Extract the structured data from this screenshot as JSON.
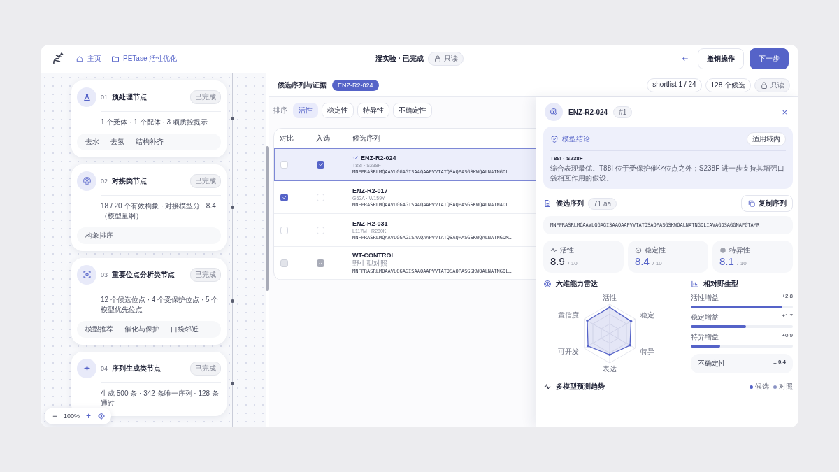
{
  "header": {
    "breadcrumbs": [
      {
        "label": "主页",
        "kind": "home"
      },
      {
        "label": "PETase 活性优化",
        "kind": "folder"
      }
    ],
    "status": "湿实验 · 已完成",
    "status_badge": "只读",
    "actions": [
      {
        "label": "撤销操作",
        "kind": "secondary"
      },
      {
        "label": "下一步",
        "kind": "primary"
      }
    ]
  },
  "pipeline": {
    "nodes": [
      {
        "index": "01",
        "title": "预处理节点",
        "status": "已完成",
        "summary": "1 个受体 · 1 个配体 · 3 项质控提示",
        "tags": [
          "去水",
          "去氢",
          "结构补齐"
        ]
      },
      {
        "index": "02",
        "title": "对接类节点",
        "status": "已完成",
        "summary": "18 / 20 个有效构象 · 对接模型分 −8.4（模型量纲）",
        "tags": [
          "构象排序"
        ]
      },
      {
        "index": "03",
        "title": "重要位点分析类节点",
        "status": "已完成",
        "summary": "12 个候选位点 · 4 个受保护位点 · 5 个模型优先位点",
        "tags": [
          "模型推荐",
          "催化与保护",
          "口袋邻近"
        ]
      },
      {
        "index": "04",
        "title": "序列生成类节点",
        "status": "已完成",
        "summary": "生成 500 条 · 342 条唯一序列 · 128 条通过"
      }
    ],
    "zoom": {
      "minus": "−",
      "value": "100%",
      "plus": "+"
    }
  },
  "candidates": {
    "title": "候选序列与证据",
    "selected_badge": "ENZ-R2-024",
    "chips": [
      "shortlist 1 / 24",
      "128 个候选"
    ],
    "readonly": "只读",
    "sort": {
      "label": "排序",
      "options": [
        {
          "label": "活性",
          "selected": true
        },
        {
          "label": "稳定性",
          "selected": false
        },
        {
          "label": "特异性",
          "selected": false
        },
        {
          "label": "不确定性",
          "selected": false
        }
      ]
    },
    "table": {
      "columns": [
        "对比",
        "入选",
        "候选序列"
      ],
      "rows": [
        {
          "name": "ENZ-R2-024",
          "mutations": "T88I · S238F",
          "sequence": "MNFPRASRLMQAAVLGGAGISAAQAAPVVTATQSAQPASGSKWQALNATNGDL…",
          "compare": false,
          "picked": true,
          "disabled": false,
          "selected": true
        },
        {
          "name": "ENZ-R2-017",
          "mutations": "G62A · W159Y",
          "sequence": "MNFPRASRLMQAAVLGGAGISAAQAAPVVTATQSAQPASGSKWQALNATNADL…",
          "compare": true,
          "picked": false,
          "disabled": false,
          "selected": false
        },
        {
          "name": "ENZ-R2-031",
          "mutations": "L117M · R280K",
          "sequence": "MNFPRASRLMQAAVLGGAGISAAQAAPVVTATQSAQPASGSKWQALNATNGDM…",
          "compare": false,
          "picked": false,
          "disabled": false,
          "selected": false
        },
        {
          "name": "WT-CONTROL",
          "mutations": "野生型对照",
          "sequence": "MNFPRASRLMQAAVLGGAGISAAQAAPVVTATQSAQPASGSKWQALNATNGDL…",
          "compare": false,
          "picked": true,
          "disabled": true,
          "selected": false
        }
      ]
    }
  },
  "detail": {
    "name": "ENZ-R2-024",
    "rank": "#1",
    "close": "×",
    "conclusion": {
      "title": "模型结论",
      "badge": "适用域内",
      "mutations": "T88I · S238F",
      "text": "综合表现最优。T88I 位于受保护催化位点之外；S238F 进一步支持其增强口袋相互作用的假设。"
    },
    "sequence": {
      "title": "候选序列",
      "length": "71 aa",
      "copy": "复制序列",
      "value": "MNFPRASRLMQAAVLGGAGISAAQAAPVVTATQSAQPASGSKWQALNATNGDLIAVAGDSAGGNAPGTAMR"
    },
    "metrics": [
      {
        "label": "活性",
        "value": "8.9",
        "scale": "/ 10",
        "highlight": false
      },
      {
        "label": "稳定性",
        "value": "8.4",
        "scale": "/ 10",
        "highlight": true
      },
      {
        "label": "特异性",
        "value": "8.1",
        "scale": "/ 10",
        "highlight": true
      }
    ],
    "radar": {
      "title": "六维能力雷达",
      "axes": [
        "活性",
        "稳定",
        "特异",
        "表达",
        "可开发",
        "置信度"
      ]
    },
    "relative": {
      "title": "相对野生型",
      "gains": [
        {
          "label": "活性增益",
          "reading": "+2.8",
          "level": 0.9
        },
        {
          "label": "稳定增益",
          "reading": "+1.7",
          "level": 0.54
        },
        {
          "label": "特异增益",
          "reading": "+0.9",
          "level": 0.29
        }
      ],
      "uncertainty": {
        "label": "不确定性",
        "value": "± 0.4"
      }
    },
    "trend": {
      "title": "多模型预测趋势",
      "legend": [
        {
          "label": "候选",
          "color": "#5563c8"
        },
        {
          "label": "对照",
          "color": "#8a93c4"
        }
      ]
    }
  }
}
